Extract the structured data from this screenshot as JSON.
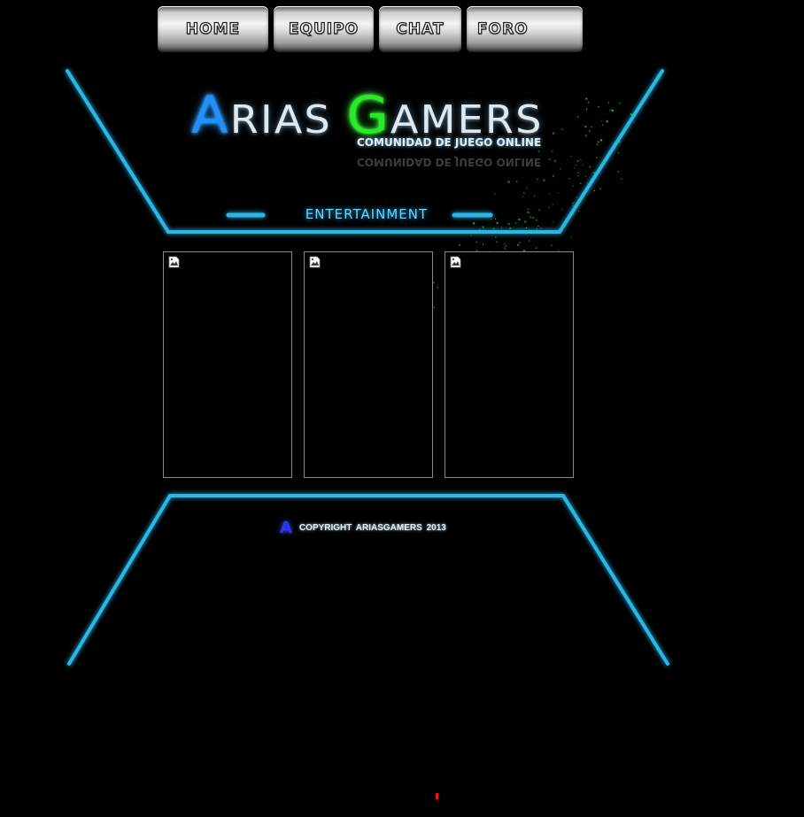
{
  "nav": {
    "items": [
      {
        "label": "HOME"
      },
      {
        "label": "EQUIPO"
      },
      {
        "label": "CHAT"
      },
      {
        "label": "FORO"
      }
    ]
  },
  "logo": {
    "title_first_initial": "A",
    "title_first_rest": "RIAS ",
    "title_second_initial": "G",
    "title_second_rest": "AMERS",
    "subtitle": "COMUNIDAD DE JUEGO ONLINE"
  },
  "tagline": "ENTERTAINMENT",
  "panels": [
    {
      "image": "broken-image-icon"
    },
    {
      "image": "broken-image-icon"
    },
    {
      "image": "broken-image-icon"
    }
  ],
  "footer": {
    "logo_letter": "A",
    "copyright": "COPYRIGHT  ARIASGAMERS 2013"
  },
  "colors": {
    "background": "#000000",
    "neon_frame": "#29b6e6",
    "accent_blue": "#1e90ff",
    "accent_green": "#22ee22",
    "particles": "#22cc22"
  }
}
